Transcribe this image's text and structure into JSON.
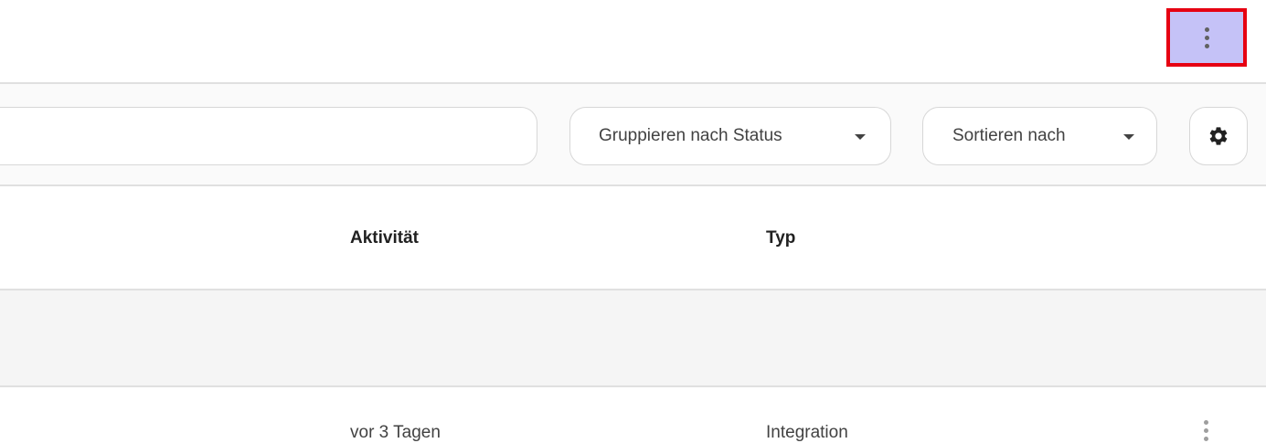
{
  "header": {
    "overflow_menu_icon": "more-vert-icon",
    "highlight_color": "#e60012"
  },
  "toolbar": {
    "search": {
      "value": "",
      "placeholder": ""
    },
    "group_by": {
      "label": "Gruppieren nach Status",
      "icon": "arrow-drop-down-icon"
    },
    "sort_by": {
      "label": "Sortieren nach",
      "icon": "arrow-drop-down-icon"
    },
    "settings_icon": "gear-icon"
  },
  "table": {
    "columns": [
      {
        "label": "Aktivität"
      },
      {
        "label": "Typ"
      }
    ],
    "rows": [
      {
        "activity": "vor 3 Tagen",
        "type": "Integration",
        "menu_icon": "more-vert-icon"
      }
    ]
  }
}
